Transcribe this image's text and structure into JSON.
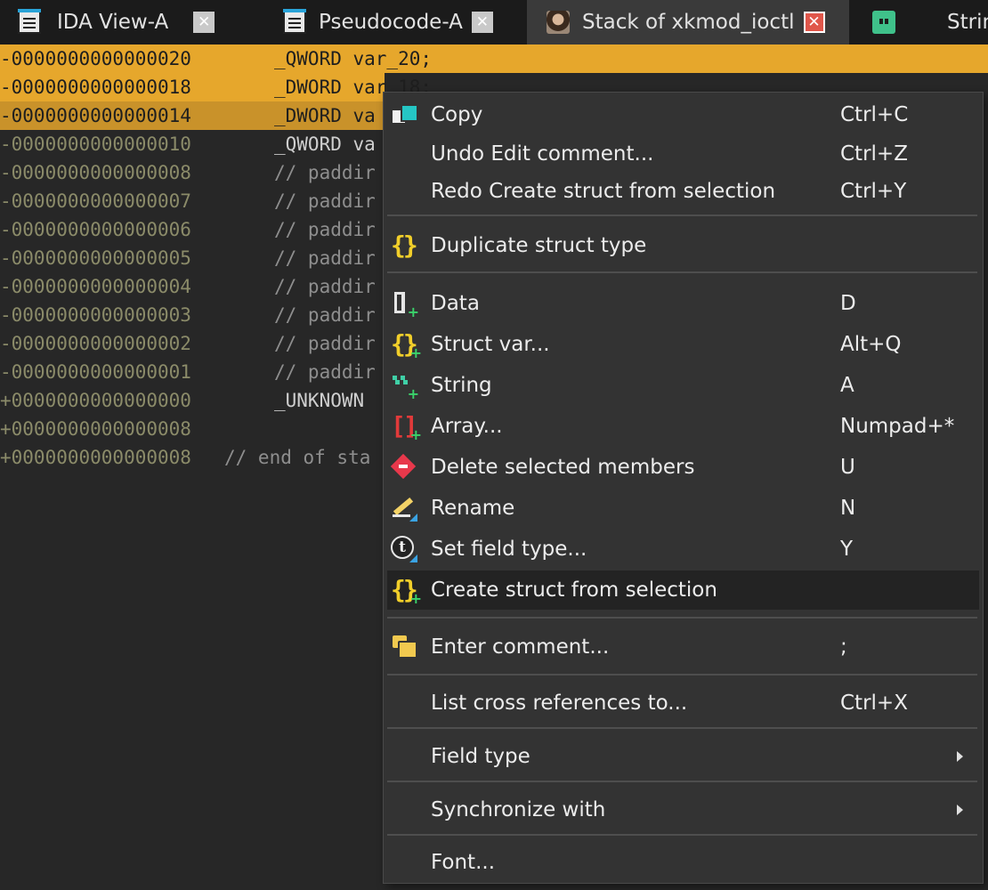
{
  "tabs": [
    {
      "label": "IDA View-A",
      "icon": "list-icon",
      "active": false
    },
    {
      "label": "Pseudocode-A",
      "icon": "list-icon",
      "active": false
    },
    {
      "label": "Stack of xkmod_ioctl",
      "icon": "portrait-icon",
      "active": true
    },
    {
      "label": "Strin",
      "icon": "string-icon",
      "active": false
    }
  ],
  "listing": {
    "rows": [
      {
        "offset": "-0000000000000020",
        "code": "_QWORD var_20;"
      },
      {
        "offset": "-0000000000000018",
        "code": "_DWORD var_18;"
      },
      {
        "offset": "-0000000000000014",
        "code": "_DWORD va"
      },
      {
        "offset": "-0000000000000010",
        "code": "_QWORD va"
      },
      {
        "offset": "-0000000000000008",
        "code": "// paddir"
      },
      {
        "offset": "-0000000000000007",
        "code": "// paddir"
      },
      {
        "offset": "-0000000000000006",
        "code": "// paddir"
      },
      {
        "offset": "-0000000000000005",
        "code": "// paddir"
      },
      {
        "offset": "-0000000000000004",
        "code": "// paddir"
      },
      {
        "offset": "-0000000000000003",
        "code": "// paddir"
      },
      {
        "offset": "-0000000000000002",
        "code": "// paddir"
      },
      {
        "offset": "-0000000000000001",
        "code": "// paddir"
      },
      {
        "offset": "+0000000000000000",
        "code": "_UNKNOWN"
      },
      {
        "offset": "+0000000000000008",
        "code": ""
      },
      {
        "offset": "+0000000000000008",
        "code": "// end of sta"
      }
    ]
  },
  "menu": {
    "items": [
      {
        "label": "Copy",
        "shortcut": "Ctrl+C",
        "icon": "copy-icon"
      },
      {
        "label": "Undo Edit comment...",
        "shortcut": "Ctrl+Z",
        "icon": ""
      },
      {
        "label": "Redo Create struct from selection",
        "shortcut": "Ctrl+Y",
        "icon": ""
      },
      {
        "label": "Duplicate struct type",
        "shortcut": "",
        "icon": "struct-braces-icon"
      },
      {
        "label": "Data",
        "shortcut": "D",
        "icon": "data-icon"
      },
      {
        "label": "Struct var...",
        "shortcut": "Alt+Q",
        "icon": "struct-var-icon"
      },
      {
        "label": "String",
        "shortcut": "A",
        "icon": "string-icon"
      },
      {
        "label": "Array...",
        "shortcut": "Numpad+*",
        "icon": "array-icon"
      },
      {
        "label": "Delete selected members",
        "shortcut": "U",
        "icon": "delete-icon"
      },
      {
        "label": "Rename",
        "shortcut": "N",
        "icon": "rename-icon"
      },
      {
        "label": "Set field type...",
        "shortcut": "Y",
        "icon": "type-icon"
      },
      {
        "label": "Create struct from selection",
        "shortcut": "",
        "icon": "create-struct-icon"
      },
      {
        "label": "Enter comment...",
        "shortcut": ";",
        "icon": "comment-icon"
      },
      {
        "label": "List cross references to...",
        "shortcut": "Ctrl+X",
        "icon": ""
      },
      {
        "label": "Field type",
        "shortcut": "",
        "icon": "submenu-arrow-icon"
      },
      {
        "label": "Synchronize with",
        "shortcut": "",
        "icon": "submenu-arrow-icon"
      },
      {
        "label": "Font...",
        "shortcut": "",
        "icon": ""
      }
    ]
  },
  "colors": {
    "selection": "#e6a72c",
    "background": "#272727",
    "menu_background": "#333333",
    "menu_hover": "#232323"
  }
}
